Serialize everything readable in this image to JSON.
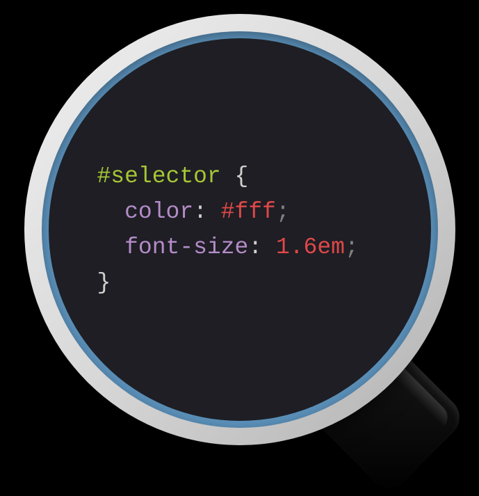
{
  "code": {
    "selector": "#selector",
    "brace_open": " {",
    "brace_close": "}",
    "declarations": [
      {
        "property": "color",
        "value": "#fff"
      },
      {
        "property": "font-size",
        "value": "1.6em"
      }
    ]
  }
}
